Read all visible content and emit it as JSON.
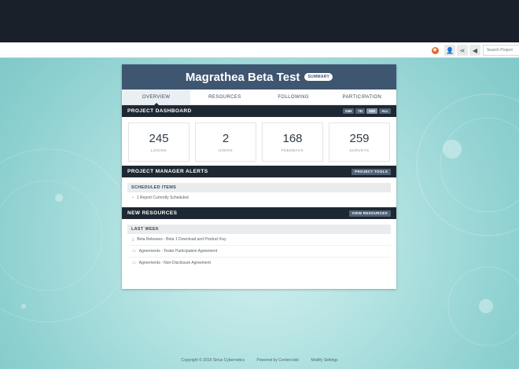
{
  "toolbar": {
    "search_placeholder": "Search Project"
  },
  "project": {
    "title": "Magrathea Beta Test",
    "badge": "SUMMARY"
  },
  "tabs": [
    {
      "label": "OVERVIEW"
    },
    {
      "label": "RESOURCES"
    },
    {
      "label": "FOLLOWING"
    },
    {
      "label": "PARTICIPATION"
    }
  ],
  "dashboard": {
    "title": "PROJECT DASHBOARD",
    "filters": [
      "24H",
      "7D",
      "30D",
      "ALL"
    ],
    "selected_filter": "30D",
    "stats": [
      {
        "value": "245",
        "label": "LOGINS"
      },
      {
        "value": "2",
        "label": "USERS"
      },
      {
        "value": "168",
        "label": "FEEDBACK"
      },
      {
        "value": "259",
        "label": "SURVEYS"
      }
    ]
  },
  "alerts": {
    "title": "PROJECT MANAGER ALERTS",
    "button": "PROJECT TOOLS",
    "sub_title": "SCHEDULED ITEMS",
    "items": [
      "1 Report Currently Scheduled"
    ]
  },
  "resources": {
    "title": "NEW RESOURCES",
    "button": "VIEW RESOURCES",
    "sub_title": "LAST WEEK",
    "items": [
      "Beta Releases - Beta 1 Download and Product Key",
      "Agreements - Tester Participation Agreement",
      "Agreements - Non-Disclosure Agreement"
    ]
  },
  "footer": {
    "copyright": "Copyright © 2019 Sirius Cybernetics",
    "powered": "Powered by Centercode",
    "settings": "Modify Settings"
  },
  "colors": {
    "topbar": "#1a2029",
    "header": "#3f5670",
    "section": "#1e2832",
    "background": "#9fd8d8"
  }
}
